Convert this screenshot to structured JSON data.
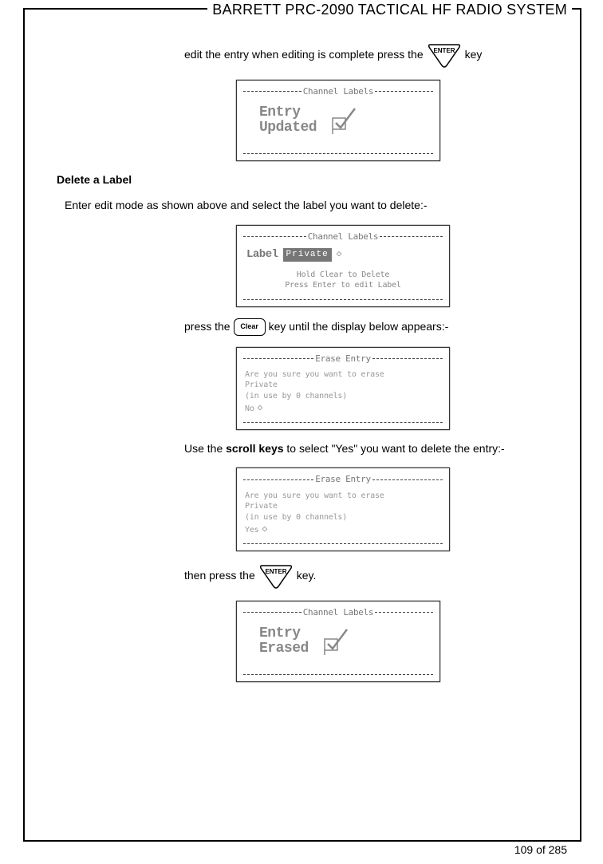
{
  "header": {
    "title": "BARRETT PRC-2090 TACTICAL HF RADIO SYSTEM"
  },
  "footer": {
    "page": "109 of 285"
  },
  "keys": {
    "enter": "ENTER",
    "clear": "Clear"
  },
  "text": {
    "line1a": "edit the entry when editing is complete press the",
    "line1b": "key",
    "deleteHead": "Delete a Label",
    "line2": "Enter edit mode as shown above and select the label you want to delete:-",
    "line3a": "press the",
    "line3b": "key until the display below appears:-",
    "line4a": "Use the ",
    "line4bold": "scroll keys",
    "line4b": " to select \"Yes\" you want to delete the entry:-",
    "line5a": "then press the",
    "line5b": "key."
  },
  "lcd1": {
    "title": "Channel Labels",
    "l1": "Entry",
    "l2": "Updated"
  },
  "lcd2": {
    "title": "Channel Labels",
    "labelWord": "Label",
    "labelSel": "Private",
    "updn": "◇",
    "hint1": "Hold Clear to Delete",
    "hint2": "Press Enter to edit Label"
  },
  "lcd3": {
    "title": "Erase Entry",
    "q": "Are you sure you want to erase",
    "name": "Private",
    "use": "(in use by 0 channels)",
    "ans": "No",
    "updn": "◇"
  },
  "lcd4": {
    "title": "Erase Entry",
    "q": "Are you sure you want to erase",
    "name": "Private",
    "use": "(in use by 0 channels)",
    "ans": "Yes",
    "updn": "◇"
  },
  "lcd5": {
    "title": "Channel Labels",
    "l1": "Entry",
    "l2": "Erased"
  }
}
